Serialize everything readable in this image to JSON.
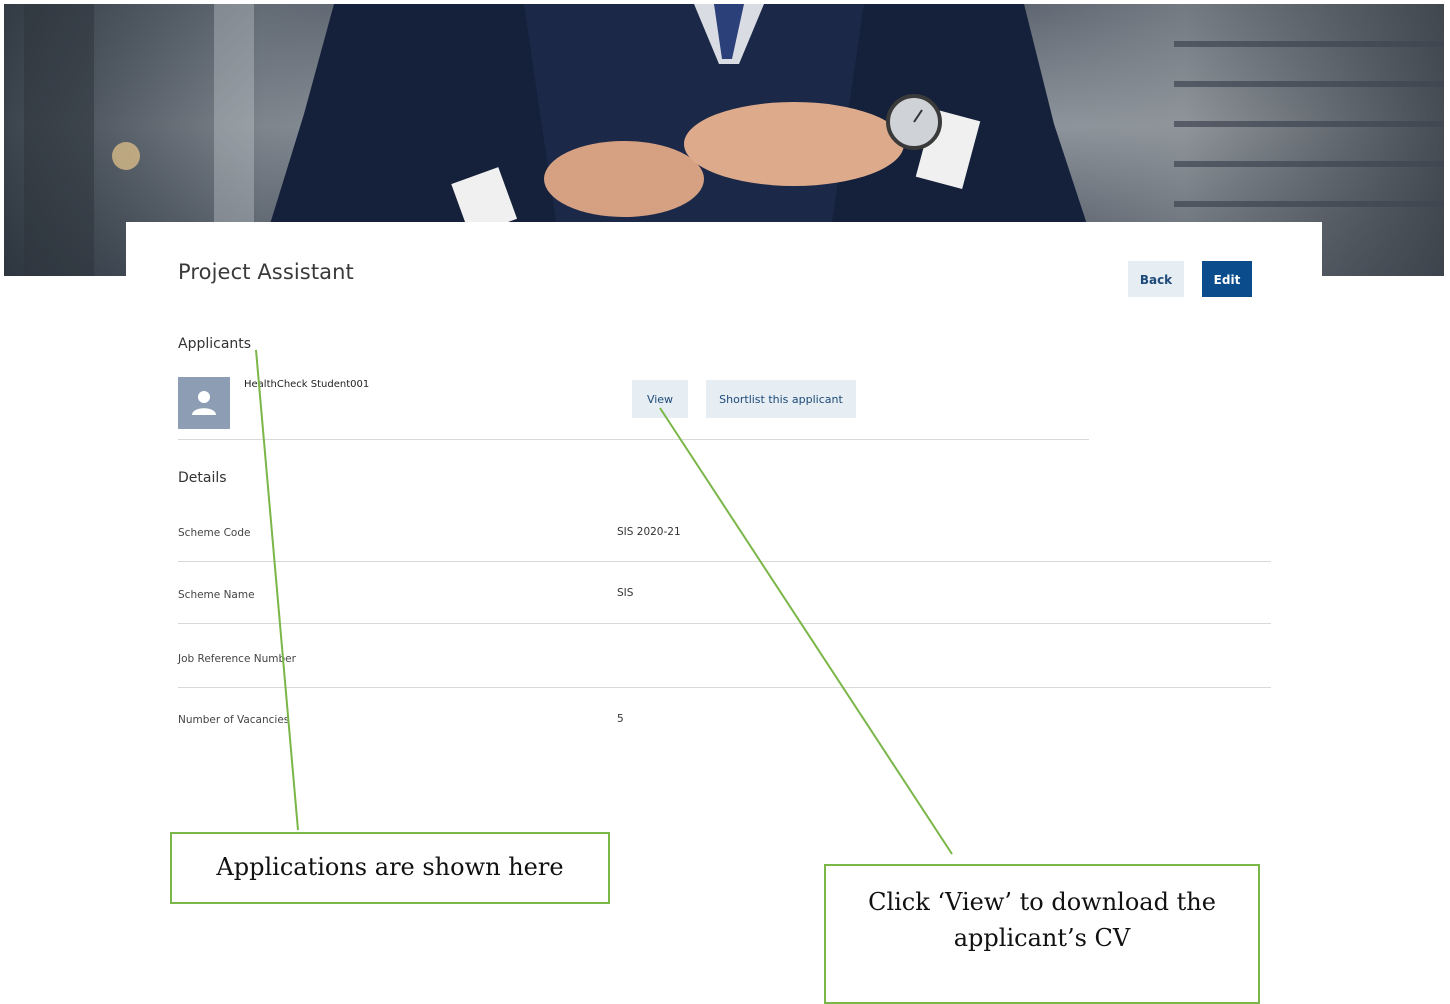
{
  "page": {
    "title": "Project Assistant",
    "back_label": "Back",
    "edit_label": "Edit"
  },
  "applicants": {
    "heading": "Applicants",
    "items": [
      {
        "name": "HealthCheck Student001",
        "view_label": "View",
        "shortlist_label": "Shortlist this applicant"
      }
    ]
  },
  "details": {
    "heading": "Details",
    "rows": [
      {
        "label": "Scheme Code",
        "value": "SIS 2020-21"
      },
      {
        "label": "Scheme Name",
        "value": "SIS"
      },
      {
        "label": "Job Reference Number",
        "value": ""
      },
      {
        "label": "Number of Vacancies",
        "value": "5"
      }
    ]
  },
  "annotations": {
    "applications_note": "Applications are shown here",
    "view_note_line1": "Click ‘View’ to download the",
    "view_note_line2": "applicant’s CV"
  },
  "colors": {
    "primary": "#0a4c8c",
    "secondary_button": "#e6edf3",
    "annotation_green": "#7ab648"
  },
  "icons": {
    "avatar": "user-silhouette-icon"
  }
}
